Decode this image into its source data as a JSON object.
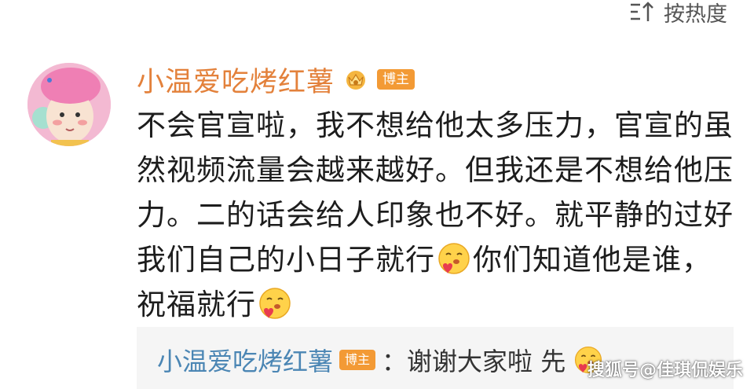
{
  "header": {
    "sort_label": "按热度",
    "sort_icon": "sort-icon"
  },
  "comment": {
    "username": "小温爱吃烤红薯",
    "badge": "博主",
    "text_1": "不会官宣啦，我不想给他太多压力，官宣的虽然视频流量会越来越好。但我还是不想给他压力。二的话会给人印象也不好。就平静的过好我们自己的小日子就行",
    "text_2": "你们知道他是谁，",
    "text_3": "祝福就行"
  },
  "reply": {
    "username": "小温爱吃烤红薯",
    "badge": "博主",
    "text": "：谢谢大家啦 先"
  },
  "watermark": "搜狐号@佳琪侃娱乐",
  "colors": {
    "username": "#e3813b",
    "reply_username": "#4b86b4",
    "badge_bg": "#f39a35",
    "reply_bg": "#f5f5f5"
  }
}
